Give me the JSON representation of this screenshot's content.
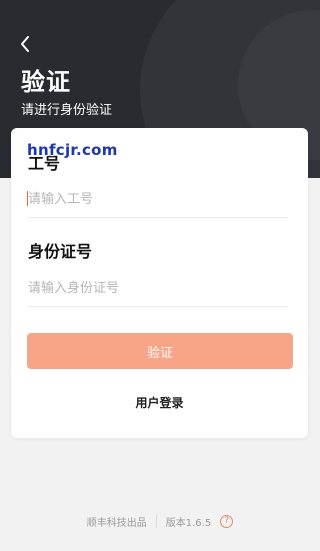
{
  "header": {
    "title": "验证",
    "subtitle": "请进行身份验证",
    "back_icon": "chevron-left-icon"
  },
  "form": {
    "employee_id_label": "工号",
    "employee_id_placeholder": "请输入工号",
    "employee_id_value": "",
    "id_card_label": "身份证号",
    "id_card_placeholder": "请输入身份证号",
    "id_card_value": "",
    "verify_button": "验证",
    "user_login_link": "用户登录"
  },
  "watermark": "hnfcjr.com",
  "footer": {
    "company": "顺丰科技出品",
    "version": "版本1.6.5",
    "help_icon": "question-circle-icon"
  },
  "colors": {
    "header_bg": "#2a2b30",
    "button_bg": "#f8a487",
    "accent": "#e58a67",
    "watermark": "#1a37b8"
  }
}
